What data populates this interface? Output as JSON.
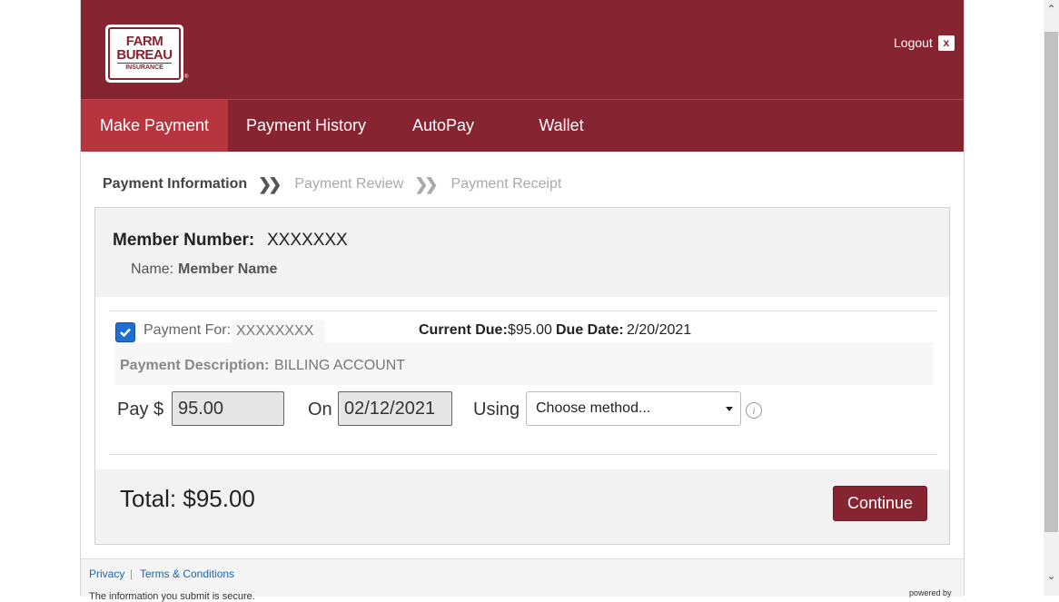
{
  "header": {
    "logo_line1": "FARM",
    "logo_line2": "BUREAU",
    "logo_line3": "INSURANCE",
    "logout_label": "Logout",
    "logout_x": "x"
  },
  "nav": {
    "items": [
      {
        "label": "Make Payment",
        "active": true
      },
      {
        "label": "Payment History"
      },
      {
        "label": "AutoPay"
      },
      {
        "label": "Wallet"
      }
    ]
  },
  "steps": [
    "Payment Information",
    "Payment Review",
    "Payment Receipt"
  ],
  "step_separator": "❯❯",
  "member": {
    "number_label": "Member Number:",
    "number_value": "XXXXXXX",
    "name_label": "Name:",
    "name_value": "Member Name"
  },
  "payment": {
    "checked": true,
    "for_label": "Payment For:",
    "for_value": "XXXXXXXX",
    "current_due_label": "Current Due:",
    "current_due_value": "$95.00",
    "due_date_label": "Due Date:",
    "due_date_value": "2/20/2021",
    "description_label": "Payment Description:",
    "description_value": "BILLING ACCOUNT",
    "pay_label": "Pay $",
    "pay_amount": "95.00",
    "on_label": "On",
    "date_value": "02/12/2021",
    "using_label": "Using",
    "method_value": "Choose method...",
    "info_symbol": "i"
  },
  "total": {
    "label": "Total: $95.00"
  },
  "continue_label": "Continue",
  "footer": {
    "privacy": "Privacy",
    "separator": "|",
    "terms": "Terms & Conditions",
    "secure_text": "The information you submit is secure.",
    "powered_by": "powered by"
  },
  "colors": {
    "brand": "#862431",
    "nav_active": "#b7353f",
    "checkbox": "#1e6fd0",
    "link": "#1a66b3"
  }
}
